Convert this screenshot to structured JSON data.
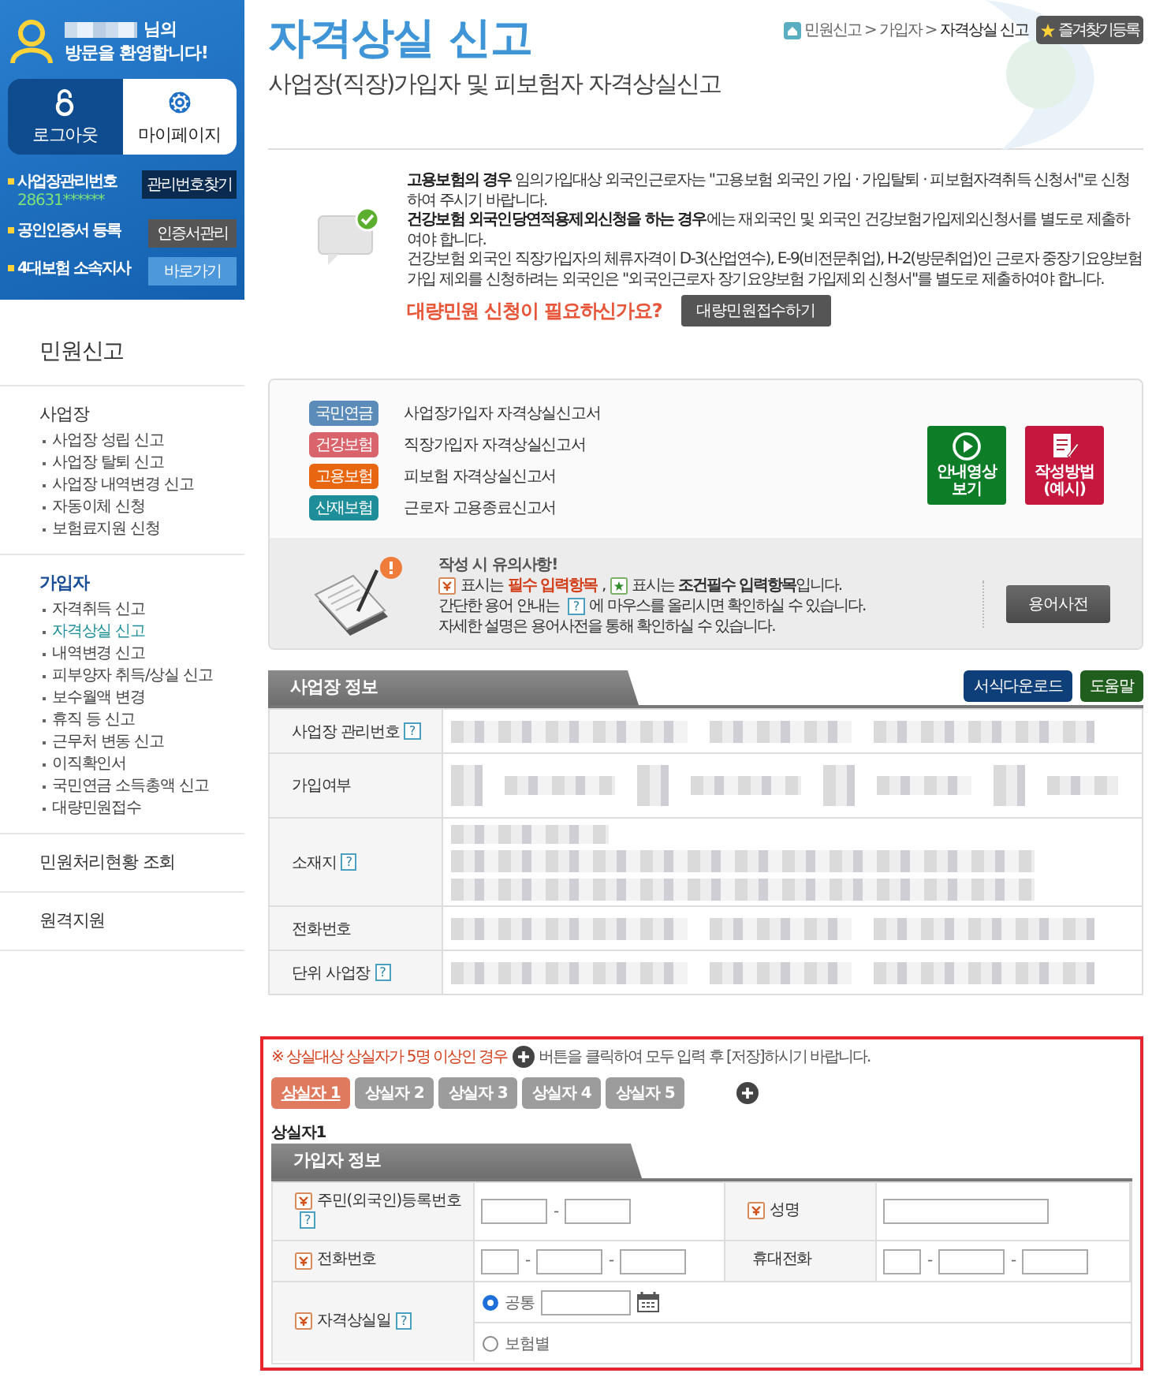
{
  "user_panel": {
    "greeting_suffix": "님의",
    "welcome": "방문을 환영합니다!",
    "buttons": [
      {
        "label": "로그아웃",
        "kind": "logout",
        "selected": true
      },
      {
        "label": "마이페이지",
        "kind": "mypage",
        "selected": false
      }
    ],
    "links": [
      {
        "label": "사업장관리번호",
        "value": "28631******",
        "button": "관리번호찾기",
        "kind": "dark"
      },
      {
        "label": "공인인증서 등록",
        "button": "인증서관리",
        "kind": "gray"
      },
      {
        "label": "4대보험 소속지사",
        "button": "바로가기",
        "kind": "light"
      }
    ]
  },
  "nav": {
    "title": "민원신고",
    "sections": [
      {
        "title": "사업장",
        "selected": false,
        "items": [
          {
            "label": "사업장 성립 신고",
            "selected": false
          },
          {
            "label": "사업장 탈퇴 신고",
            "selected": false
          },
          {
            "label": "사업장 내역변경 신고",
            "selected": false
          },
          {
            "label": "자동이체 신청",
            "selected": false
          },
          {
            "label": "보험료지원 신청",
            "selected": false
          }
        ]
      },
      {
        "title": "가입자",
        "selected": true,
        "items": [
          {
            "label": "자격취득 신고",
            "selected": false
          },
          {
            "label": "자격상실 신고",
            "selected": true
          },
          {
            "label": "내역변경 신고",
            "selected": false
          },
          {
            "label": "피부양자 취득/상실 신고",
            "selected": false
          },
          {
            "label": "보수월액 변경",
            "selected": false
          },
          {
            "label": "휴직 등 신고",
            "selected": false
          },
          {
            "label": "근무처 변동 신고",
            "selected": false
          },
          {
            "label": "이직확인서",
            "selected": false
          },
          {
            "label": "국민연금 소득총액 신고",
            "selected": false
          },
          {
            "label": "대량민원접수",
            "selected": false
          }
        ]
      },
      {
        "title": "민원처리현황 조회",
        "selected": false
      },
      {
        "title": "원격지원",
        "selected": false
      }
    ]
  },
  "header": {
    "title": "자격상실 신고",
    "subtitle": "사업장(직장)가입자 및 피보험자 자격상실신고",
    "breadcrumb": [
      {
        "label": "민원신고",
        "current": false
      },
      {
        "label": "가입자",
        "current": false
      },
      {
        "label": "자격상실 신고",
        "current": true
      }
    ],
    "separator": ">",
    "bookmark": "즐겨찾기등록"
  },
  "notice": {
    "paragraphs": [
      "**고용보험의 경우** 임의가입대상 외국인근로자는 \"고용보험 외국인 가입 · 가입탈퇴 · 피보험자격취득 신청서\"로 신청하여 주시기 바랍니다.",
      "**건강보험 외국인당연적용제외신청을 하는 경우**에는 재외국인 및 외국인 건강보험가입제외신청서를 별도로 제출하여야 합니다.",
      "건강보험 외국인 직장가입자의 체류자격이 D-3(산업연수), E-9(비전문취업), H-2(방문취업)인 근로자 중장기요양보험 가입 제외를 신청하려는 외국인은 \"외국인근로자 장기요양보험 가입제외 신청서\"를 별도로 제출하여야 합니다."
    ],
    "question": "대량민원 신청이 필요하신가요?",
    "button": "대량민원접수하기"
  },
  "forms": {
    "rows": [
      {
        "tag": "국민연금",
        "color": "#5b8cb9",
        "form": "사업장가입자 자격상실신고서"
      },
      {
        "tag": "건강보험",
        "color": "#d9646c",
        "form": "직장가입자 자격상실신고서"
      },
      {
        "tag": "고용보험",
        "color": "#e8660f",
        "form": "피보험 자격상실신고서"
      },
      {
        "tag": "산재보험",
        "color": "#1d8e9a",
        "form": "근로자 고용종료신고서"
      }
    ],
    "buttons": [
      {
        "kind": "video",
        "label": "안내영상 보기"
      },
      {
        "kind": "guide",
        "label": "작성방법 (예시)"
      }
    ],
    "caution": {
      "title": "작성 시 유의사항!",
      "lines": [
        [
          {
            "kind": "required"
          },
          {
            "kind": "text",
            "text": "표시는"
          },
          {
            "kind": "emphasis",
            "text": "필수 입력항목"
          },
          {
            "kind": "text",
            "text": ","
          },
          {
            "kind": "conditional"
          },
          {
            "kind": "text",
            "text": "표시는 **조건필수 입력항목**입니다."
          }
        ],
        [
          {
            "kind": "text",
            "text": "간단한 용어 안내는"
          },
          {
            "kind": "help",
            "text": "?"
          },
          {
            "kind": "text",
            "text": "에 마우스를 올리시면 확인하실 수 있습니다."
          }
        ],
        [
          {
            "kind": "text",
            "text": "자세한 설명은 용어사전을 통해 확인하실 수 있습니다."
          }
        ]
      ],
      "button": "용어사전"
    }
  },
  "business": {
    "title": "사업장 정보",
    "buttons": [
      {
        "kind": "download",
        "label": "서식다운로드"
      },
      {
        "kind": "help",
        "label": "도움말"
      }
    ],
    "rows": [
      {
        "label": "사업장 관리번호",
        "help": "?",
        "kind": "line"
      },
      {
        "label": "가입여부",
        "kind": "status"
      },
      {
        "label": "소재지",
        "help": "?",
        "kind": "address"
      },
      {
        "label": "전화번호",
        "kind": "line"
      },
      {
        "label": "단위 사업장",
        "help": "?",
        "kind": "line"
      }
    ]
  },
  "loss": {
    "highlighted": true,
    "notice": [
      {
        "kind": "alert",
        "text": "※ 상실대상 상실자가 5명 이상인 경우"
      },
      {
        "kind": "plus"
      },
      {
        "kind": "text",
        "text": "버튼을 클릭하여 모두 입력 후 [저장]하시기 바랍니다."
      }
    ],
    "tabs": [
      {
        "label": "상실자 1",
        "selected": true
      },
      {
        "label": "상실자 2",
        "selected": false
      },
      {
        "label": "상실자 3",
        "selected": false
      },
      {
        "label": "상실자 4",
        "selected": false
      },
      {
        "label": "상실자 5",
        "selected": false
      }
    ],
    "subtitle": "상실자1",
    "section": "가입자 정보",
    "rows": [
      [
        {
          "label": "주민(외국인)등록번호",
          "required": true,
          "help": "?",
          "kind": "resident",
          "separator": "-"
        },
        {
          "label": "성명",
          "required": true,
          "kind": "name"
        }
      ],
      [
        {
          "label": "전화번호",
          "required": true,
          "kind": "phone",
          "separator": "-"
        },
        {
          "label": "휴대전화",
          "required": false,
          "kind": "phone",
          "separator": "-"
        }
      ]
    ],
    "date_row": {
      "label": "자격상실일",
      "required": true,
      "help": "?",
      "options": [
        {
          "label": "공통",
          "selected": true,
          "date": true
        },
        {
          "label": "보험별",
          "selected": false,
          "date": false
        }
      ]
    }
  }
}
